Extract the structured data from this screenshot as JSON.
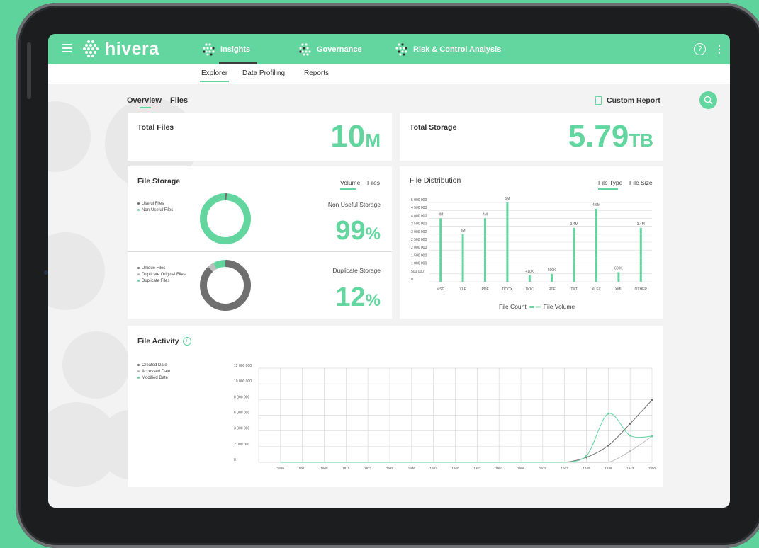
{
  "app": {
    "name": "hivera"
  },
  "nav": {
    "tabs": [
      {
        "label": "Insights",
        "active": true
      },
      {
        "label": "Governance",
        "active": false
      },
      {
        "label": "Risk & Control Analysis",
        "active": false
      }
    ],
    "help_icon": "?",
    "menu_icon": "⋮"
  },
  "subnav": {
    "items": [
      {
        "label": "Explorer",
        "active": true
      },
      {
        "label": "Data Profiling",
        "active": false
      },
      {
        "label": "Reports",
        "active": false
      }
    ]
  },
  "view_tabs": [
    {
      "label": "Overview",
      "active": true
    },
    {
      "label": "Files",
      "active": false
    }
  ],
  "custom_report": {
    "label": "Custom Report"
  },
  "colors": {
    "accent": "#63d59e",
    "dark": "#6f6f6f",
    "gray": "#bdbdbd"
  },
  "total_files": {
    "title": "Total Files",
    "value": "10",
    "unit": "M"
  },
  "total_storage": {
    "title": "Total Storage",
    "value": "5.79",
    "unit": "TB"
  },
  "file_storage": {
    "title": "File Storage",
    "toggle": [
      "Volume",
      "Files"
    ],
    "chart1": {
      "legend": [
        "Useful Files",
        "Non-Useful Files"
      ],
      "label": "Non Useful Storage",
      "value": "99",
      "unit": "%",
      "fractions": [
        0.01,
        0.99
      ]
    },
    "chart2": {
      "legend": [
        "Unique Files",
        "Duplicate Original Files",
        "Duplicate Files"
      ],
      "label": "Duplicate Storage",
      "value": "12",
      "unit": "%",
      "fractions": [
        0.88,
        0.04,
        0.08
      ]
    }
  },
  "file_distribution": {
    "title": "File Distribution",
    "toggle": [
      "File Type",
      "File Size"
    ],
    "legend": {
      "a": "File Count",
      "b": "File Volume"
    }
  },
  "file_activity": {
    "title": "File Activity",
    "info_icon": "i",
    "legend": [
      "Created Date",
      "Accessed Date",
      "Modified Date"
    ]
  },
  "chart_data": [
    {
      "type": "bar",
      "categories": [
        "MSG",
        "XLF",
        "PDF",
        "DOCX",
        "DOC",
        "RTF",
        "TXT",
        "XLSX",
        "XML",
        "OTHER"
      ],
      "values": [
        4000000,
        3000000,
        4000000,
        5000000,
        410000,
        500000,
        3400000,
        4600000,
        600000,
        3400000
      ],
      "data_labels": [
        "4M",
        "3M",
        "4M",
        "5M",
        "410K",
        "500K",
        "3.4M",
        "4.6M",
        "600K",
        "3.4M"
      ],
      "y_ticks": [
        "5 000 000",
        "4 500 000",
        "4 000 000",
        "3 500 000",
        "3 000 000",
        "2 500 000",
        "2 000 000",
        "1 500 000",
        "1 000 000",
        "500 000",
        "0"
      ],
      "ylim": [
        0,
        5000000
      ],
      "grid": true
    },
    {
      "type": "line",
      "x": [
        "1899",
        "1901",
        "1908",
        "1915",
        "1922",
        "1929",
        "1936",
        "1943",
        "1950",
        "1957",
        "1901",
        "1908",
        "1915",
        "1922",
        "1929",
        "1936",
        "1943",
        "1950"
      ],
      "y_ticks": [
        "12 000 000",
        "10 000 000",
        "8 000 000",
        "6 000 000",
        "3 000 000",
        "2 000 000",
        "0"
      ],
      "series": [
        {
          "name": "Created Date",
          "color": "#6f6f6f",
          "values": [
            0,
            0,
            0,
            0,
            0,
            0,
            0,
            0,
            0,
            0,
            0,
            0,
            0,
            0,
            0.08,
            0.27,
            0.62,
            1.0
          ]
        },
        {
          "name": "Accessed Date",
          "color": "#bdbdbd",
          "values": [
            0,
            0,
            0,
            0,
            0,
            0,
            0,
            0,
            0,
            0,
            0,
            0,
            0,
            0,
            0,
            0,
            0.18,
            0.42
          ]
        },
        {
          "name": "Modified Date",
          "color": "#63d59e",
          "values": [
            0,
            0,
            0,
            0,
            0,
            0,
            0,
            0,
            0,
            0,
            0,
            0,
            0,
            0,
            0.1,
            0.78,
            0.43,
            0.42
          ]
        }
      ],
      "grid": true
    }
  ]
}
